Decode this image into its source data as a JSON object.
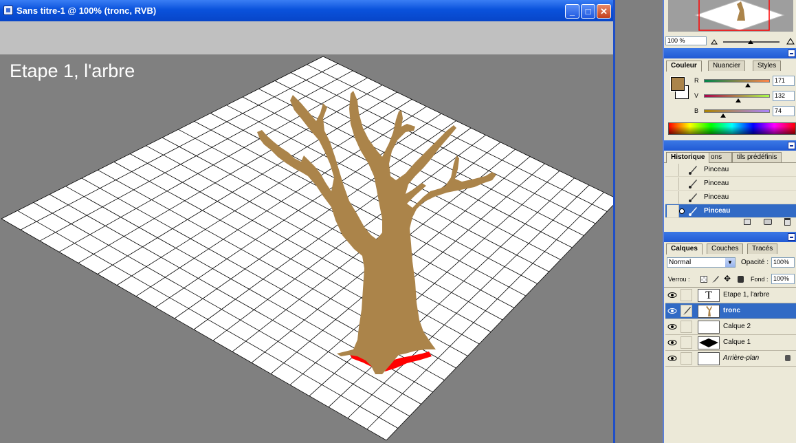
{
  "window": {
    "title": "Sans titre-1 @ 100% (tronc, RVB)",
    "minimize_label": "_",
    "maximize_label": "□",
    "close_label": "✕"
  },
  "canvas": {
    "title_text": "Etape 1, l'arbre",
    "tree_color": "#ab844a",
    "grid_fill": "#ffffff",
    "grid_line": "#000000",
    "base_mark_color": "#ff0000"
  },
  "navigator": {
    "zoom": "100 %"
  },
  "color_panel": {
    "tabs": [
      "Couleur",
      "Nuancier",
      "Styles"
    ],
    "active_tab": "Couleur",
    "foreground": "#ab844a",
    "background": "#ffffff",
    "channels": [
      {
        "label": "R",
        "value": "171",
        "fraction": 0.67
      },
      {
        "label": "V",
        "value": "132",
        "fraction": 0.52
      },
      {
        "label": "B",
        "value": "74",
        "fraction": 0.29
      }
    ]
  },
  "history_panel": {
    "tabs": [
      "Historique",
      "Actions",
      "Outils prédéfinis"
    ],
    "tab_visible": [
      "Historique",
      "ons",
      "tils prédéfinis"
    ],
    "items": [
      {
        "label": "Pinceau",
        "selected": false
      },
      {
        "label": "Pinceau",
        "selected": false
      },
      {
        "label": "Pinceau",
        "selected": false
      },
      {
        "label": "Pinceau",
        "selected": true
      }
    ]
  },
  "layers_panel": {
    "tabs": [
      "Calques",
      "Couches",
      "Tracés"
    ],
    "active_tab": "Calques",
    "blend_mode": "Normal",
    "opacity_label": "Opacité :",
    "opacity": "100%",
    "lock_label": "Verrou :",
    "fill_label": "Fond :",
    "fill": "100%",
    "layers": [
      {
        "name": "Etape 1, l'arbre",
        "type": "text",
        "selected": false
      },
      {
        "name": "tronc",
        "type": "tree",
        "selected": true
      },
      {
        "name": "Calque 2",
        "type": "transparent",
        "selected": false
      },
      {
        "name": "Calque 1",
        "type": "diamond",
        "selected": false
      },
      {
        "name": "Arrière-plan",
        "type": "background",
        "selected": false,
        "locked": true
      }
    ]
  }
}
